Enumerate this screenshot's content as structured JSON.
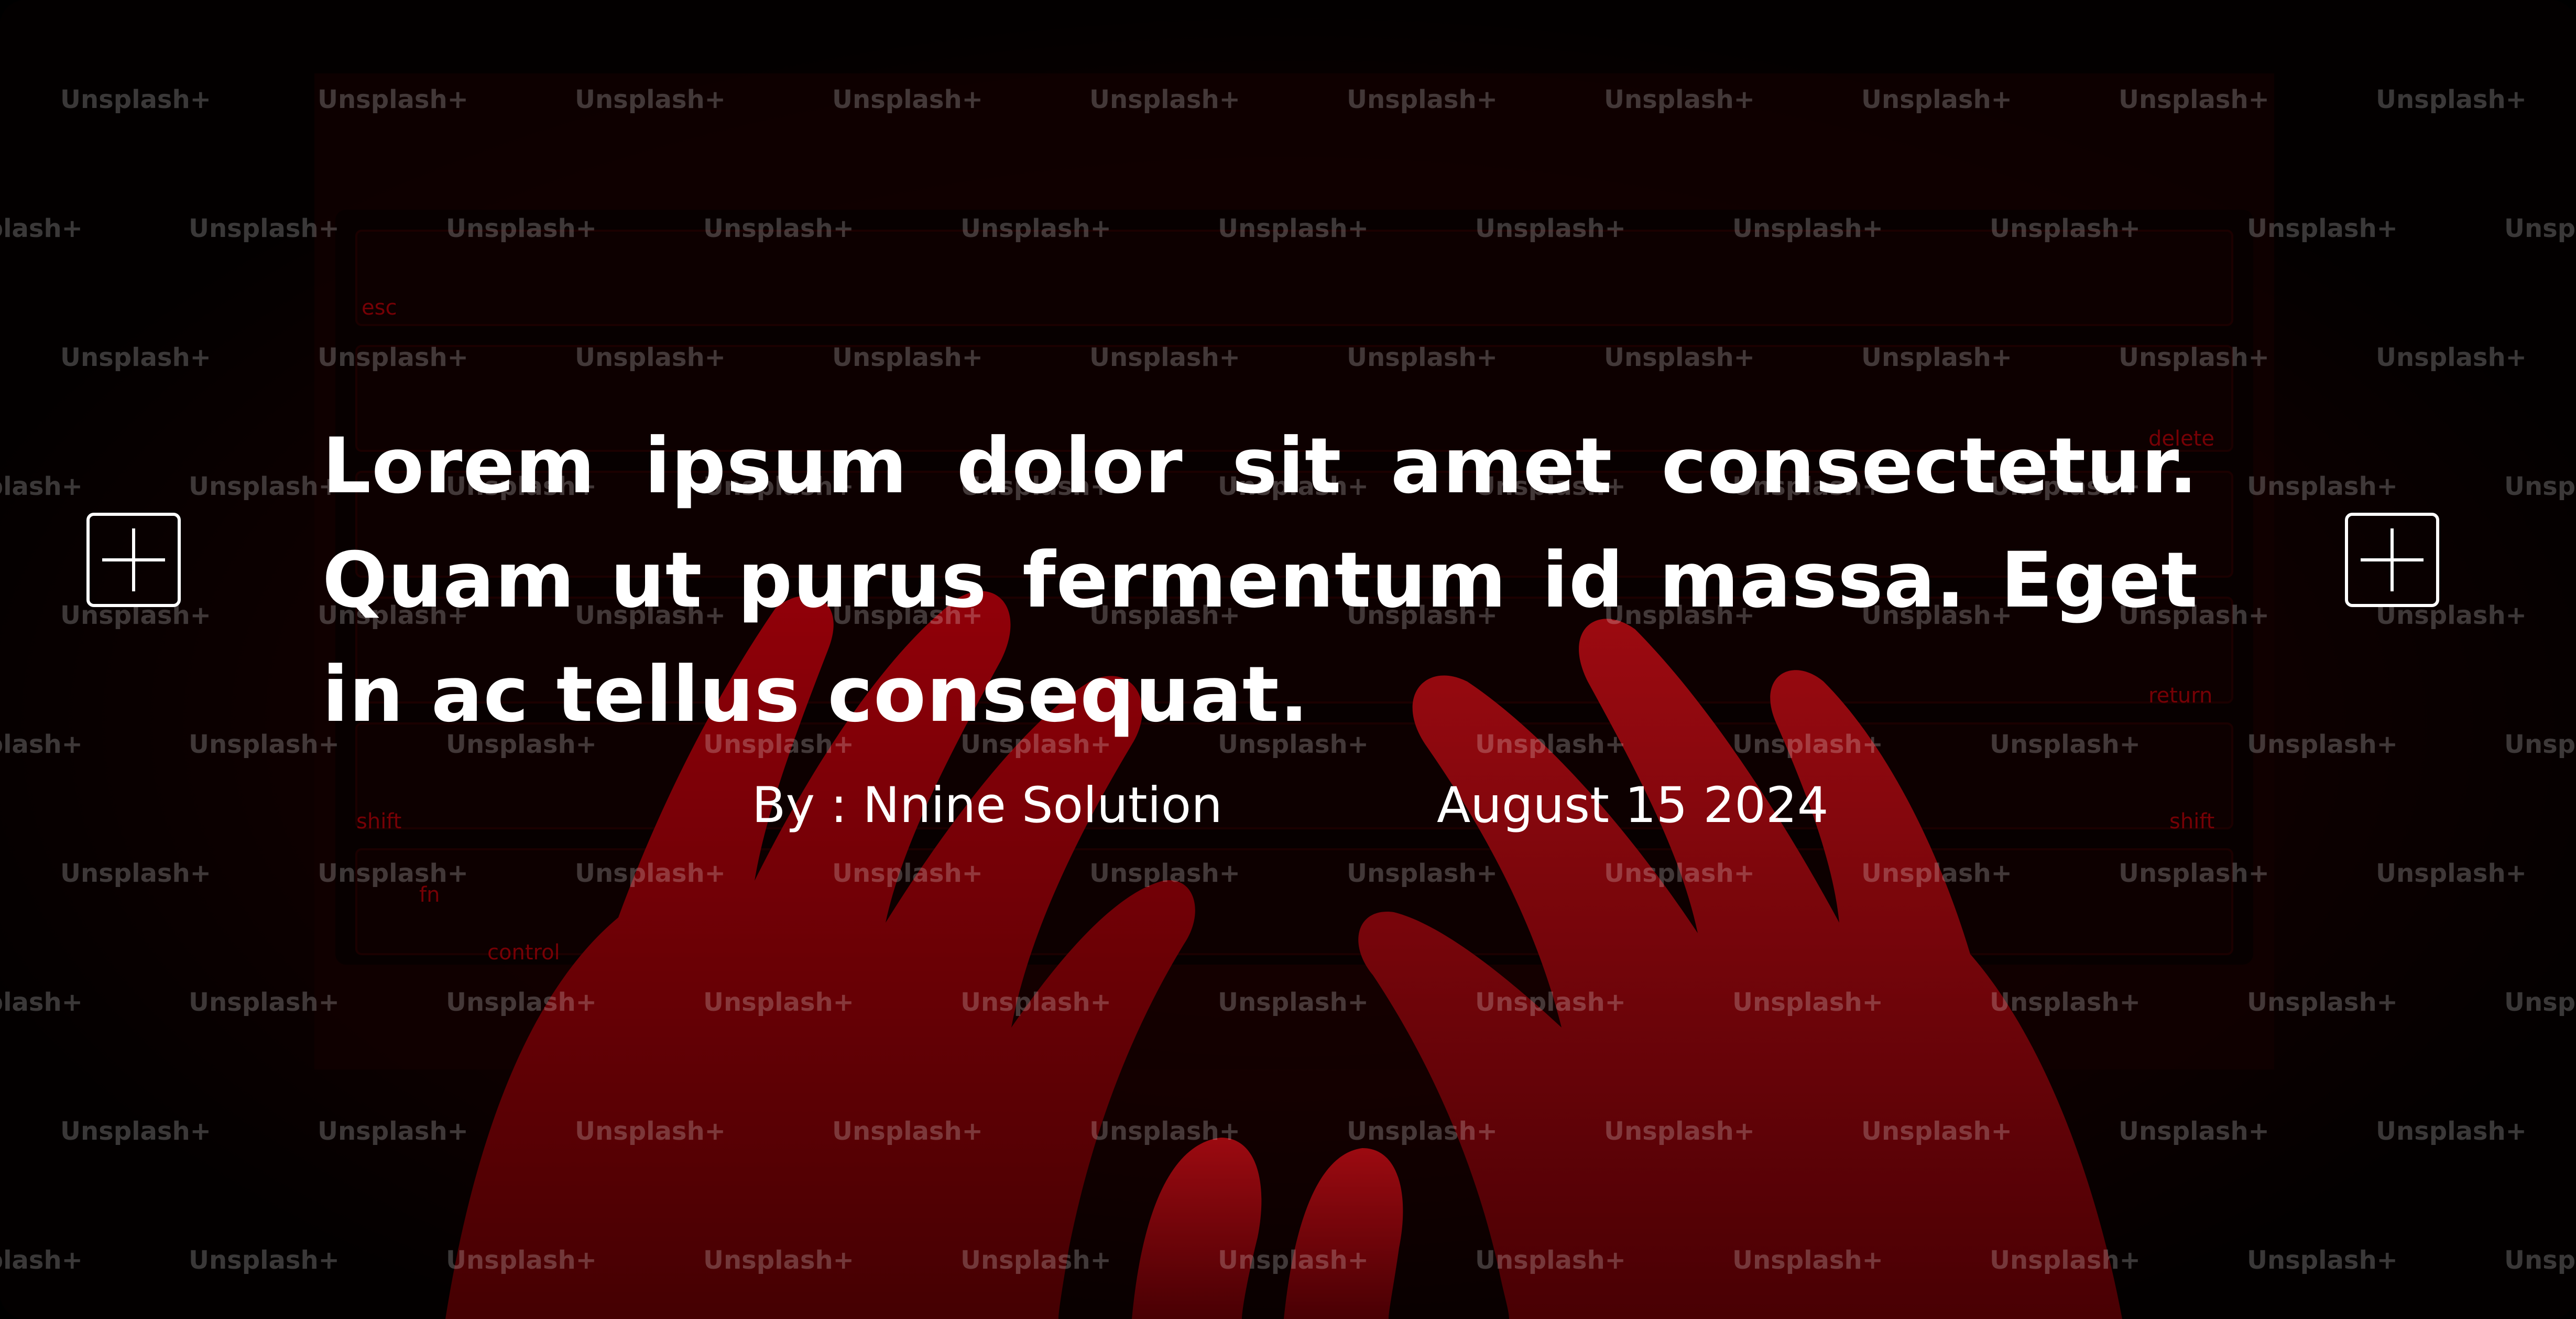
{
  "hero": {
    "headline": "Lorem ipsum dolor sit amet consectetur. Quam ut purus fermentum id massa. Eget in ac tellus consequat.",
    "author": "By : Nnine Solution",
    "date": "August 15 2024",
    "watermark_text": "Unsplash+",
    "prev_button_icon": "plus-icon",
    "next_button_icon": "plus-icon"
  },
  "colors": {
    "text": "#ffffff",
    "background": "#000000",
    "accent_red": "#c0000a"
  }
}
